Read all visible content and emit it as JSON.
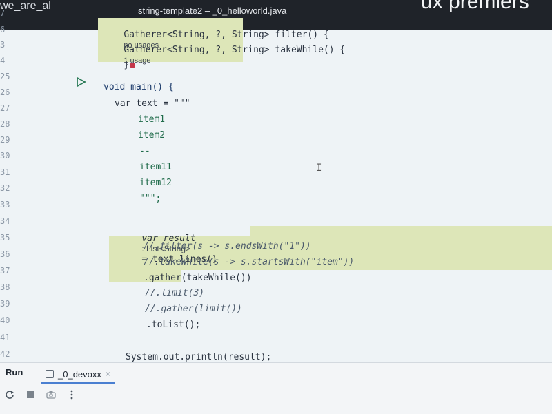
{
  "window": {
    "title": "string-template2 – _0_helloworld.java",
    "banner_text": "ux premiers",
    "corner_text": "we_are_al"
  },
  "line_numbers": [
    "7",
    "6",
    "3",
    "4",
    "25",
    "26",
    "27",
    "28",
    "29",
    "30",
    "31",
    "32",
    "33",
    "34",
    "35",
    "36",
    "37",
    "38",
    "39",
    "40",
    "41",
    "42"
  ],
  "code": {
    "filter_decl": "Gatherer<String, ?, String> filter() {",
    "filter_hint": "no usages",
    "takewhile_decl": "Gatherer<String, ?, String> takeWhile() {",
    "takewhile_hint": "1 usage",
    "closing_brace": "}",
    "main_decl": "void main() {",
    "text_decl": "var text = \"\"\"",
    "item1": "item1",
    "item2": "item2",
    "dashes": "--",
    "item11": "item11",
    "item12": "item12",
    "text_end": "\"\"\";",
    "result_decl_pre": "var result",
    "result_type_hint": ": List<String>",
    "result_decl_post": "= text.lines()",
    "filter_comment": "//.filter(s -> s.endsWith(\"1\"))",
    "takewhile_comment": "//.takeWhile(s -> s.startsWith(\"item\"))",
    "gather_call": ".gather(takeWhile())",
    "limit_comment": "//.limit(3)",
    "gather_limit_comment": "//.gather(limit())",
    "tolist_call": ".toList();",
    "println": "System.out.println(result);"
  },
  "run_panel": {
    "label": "Run",
    "tab_label": "_0_devoxx",
    "tab_close": "×"
  },
  "toolbar_icons": [
    "rerun-icon",
    "stop-icon",
    "camera-icon",
    "more-vertical-icon"
  ],
  "colors": {
    "editor_bg": "#eef3f6",
    "highlight": "#dde6b8",
    "titlebar_bg": "#1f2329"
  }
}
